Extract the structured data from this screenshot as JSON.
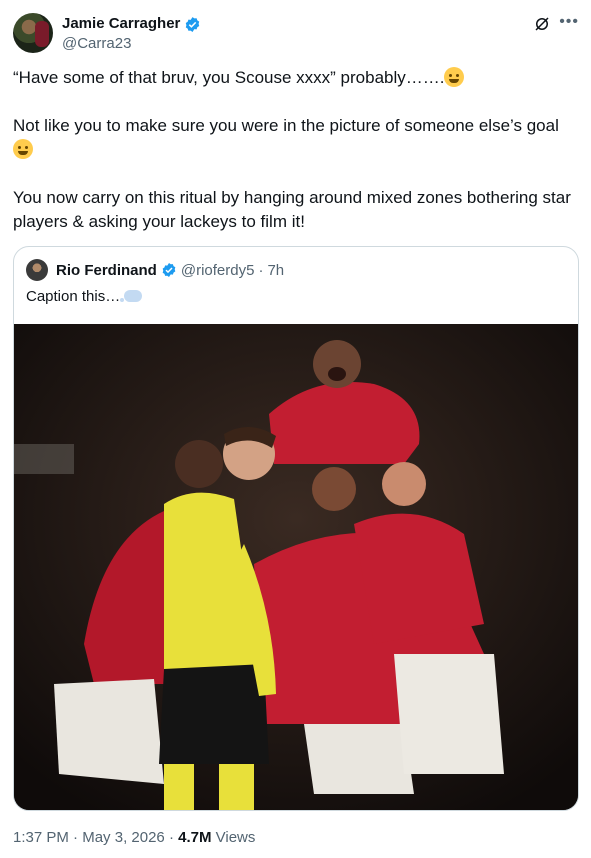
{
  "author": {
    "name": "Jamie Carragher",
    "handle": "@Carra23"
  },
  "tweet": {
    "paragraphs": [
      "“Have some of that bruv, you Scouse xxxx” probably…….",
      "Not like you to make sure you were in the picture of someone else’s goal",
      "You now carry on this ritual by hanging around mixed zones bothering star players & asking your lackeys to film it!"
    ]
  },
  "quoted": {
    "name": "Rio Ferdinand",
    "handle": "@rioferdy5",
    "separator": "·",
    "age": "7h",
    "text": "Caption this…"
  },
  "meta": {
    "time": "1:37 PM",
    "sep1": " · ",
    "date": "May 3, 2026",
    "sep2": " · ",
    "views_count": "4.7M",
    "views_label": " Views"
  },
  "colors": {
    "verified": "#1d9bf0",
    "secondary_text": "#536471",
    "border": "#cfd9de"
  },
  "icons": {
    "verified": "verified-badge-icon",
    "grok": "grok-icon",
    "more": "more-icon",
    "emoji_laugh": "tears-of-joy-emoji",
    "emoji_sweat": "grinning-sweat-emoji",
    "bubble": "thought-balloon-emoji"
  }
}
